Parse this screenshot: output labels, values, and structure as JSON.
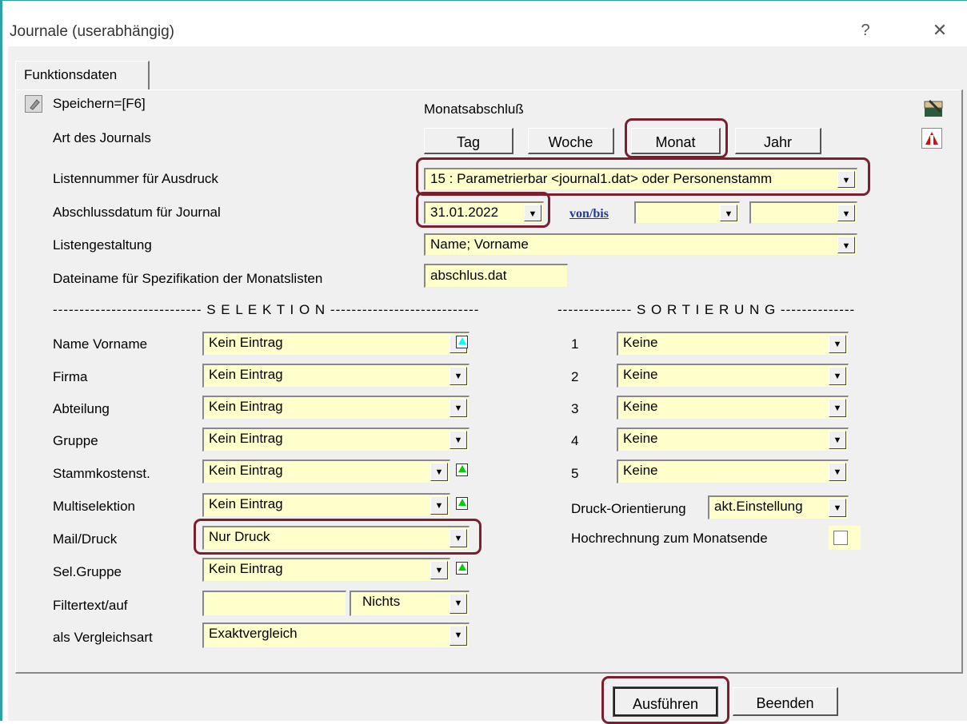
{
  "window": {
    "title": "Journale (userabhängig)",
    "help": "?",
    "close": "✕"
  },
  "tab": "Funktionsdaten",
  "header": {
    "save_label": "Speichern=[F6]",
    "period_label": "Monatsabschluß"
  },
  "labels": {
    "art": "Art des Journals",
    "listennummer": "Listennummer für Ausdruck",
    "abschlussdatum": "Abschlussdatum für Journal",
    "listengestaltung": "Listengestaltung",
    "dateiname": "Dateiname für Spezifikation der Monatslisten"
  },
  "period_buttons": [
    "Tag",
    "Woche",
    "Monat",
    "Jahr"
  ],
  "listennummer_value": "15 : Parametrierbar <journal1.dat> oder Personenstamm",
  "datum_value": "31.01.2022",
  "vonbis": "von/bis",
  "listengestaltung_value": "Name; Vorname",
  "dateiname_value": "abschlus.dat",
  "selektion": {
    "header": "---------------------------- S E L E K T I O N ----------------------------",
    "rows": [
      {
        "label": "Name Vorname",
        "value": "Kein Eintrag"
      },
      {
        "label": "Firma",
        "value": "Kein Eintrag"
      },
      {
        "label": "Abteilung",
        "value": "Kein Eintrag"
      },
      {
        "label": "Gruppe",
        "value": "Kein Eintrag"
      },
      {
        "label": "Stammkostenst.",
        "value": "Kein Eintrag"
      },
      {
        "label": "Multiselektion",
        "value": "Kein Eintrag"
      },
      {
        "label": "Mail/Druck",
        "value": "Nur Druck"
      },
      {
        "label": "Sel.Gruppe",
        "value": "Kein Eintrag"
      }
    ],
    "filter_label": "Filtertext/auf",
    "filter_text": "",
    "filter_op": "Nichts",
    "vergleich_label": "als Vergleichsart",
    "vergleich_value": "Exaktvergleich"
  },
  "sortierung": {
    "header": "-------------- S O R T I E R U N G --------------",
    "rows": [
      {
        "num": "1",
        "value": "Keine"
      },
      {
        "num": "2",
        "value": "Keine"
      },
      {
        "num": "3",
        "value": "Keine"
      },
      {
        "num": "4",
        "value": "Keine"
      },
      {
        "num": "5",
        "value": "Keine"
      }
    ],
    "druck_label": "Druck-Orientierung",
    "druck_value": "akt.Einstellung",
    "hochrechnung_label": "Hochrechnung zum Monatsende",
    "hochrechnung_checked": false
  },
  "footer": {
    "run": "Ausführen",
    "quit": "Beenden"
  },
  "colors": {
    "field_bg": "#ffffcc",
    "highlight": "#7a1f2e",
    "window_border": "#2aa3a3"
  }
}
